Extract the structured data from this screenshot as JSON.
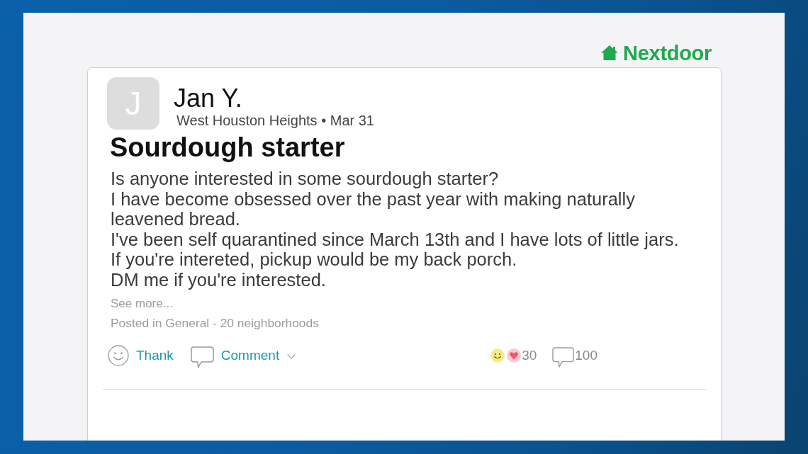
{
  "brand": {
    "name": "Nextdoor"
  },
  "post": {
    "author": {
      "initial": "J",
      "name": "Jan Y."
    },
    "meta": "West Houston Heights • Mar 31",
    "title": "Sourdough starter",
    "body": [
      "Is anyone interested in some sourdough starter?",
      "I have become obsessed over the past year with making naturally leavened bread.",
      "I've been self quarantined since March 13th and I have lots of little jars.",
      "If you're intereted, pickup would be my back porch.",
      "DM me if you're interested."
    ],
    "see_more": "See more...",
    "posted_in": "Posted in General - 20 neighborhoods",
    "actions": [
      {
        "kind": "thank",
        "label": "Thank"
      },
      {
        "kind": "comment",
        "label": "Comment"
      }
    ],
    "reactions": {
      "count": "30"
    },
    "comments": {
      "count": "100"
    }
  }
}
